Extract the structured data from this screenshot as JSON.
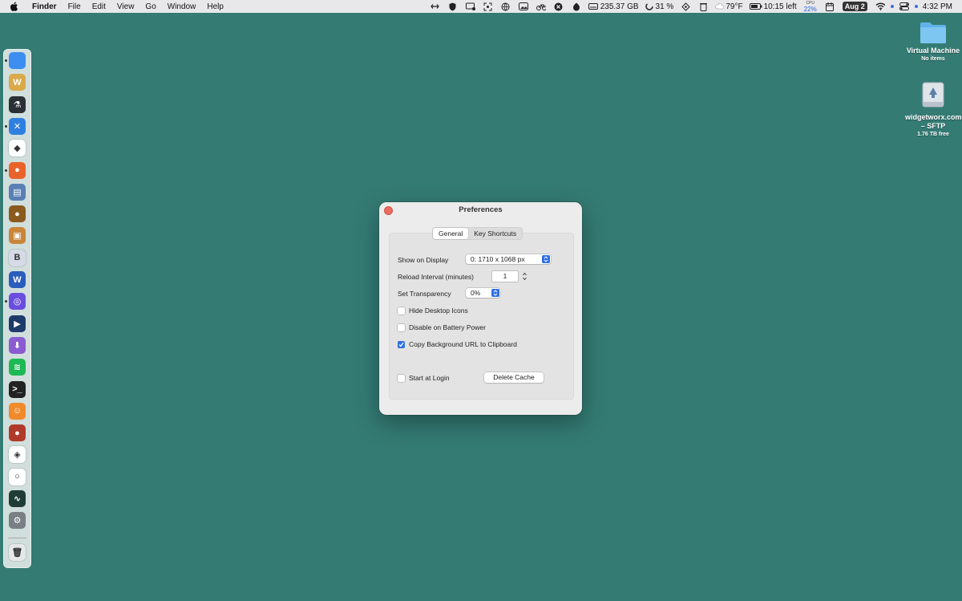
{
  "menubar": {
    "app_name": "Finder",
    "menus": [
      "File",
      "Edit",
      "View",
      "Go",
      "Window",
      "Help"
    ],
    "status": {
      "disk": "235.37 GB",
      "progress": "31 %",
      "weather": "79°F",
      "battery": "10:15 left",
      "cpu_label": "CPU",
      "cpu_value": "22%",
      "date": "Aug 2",
      "time": "4:32 PM"
    }
  },
  "desktop": {
    "items": [
      {
        "name": "Virtual Machine",
        "sub": "No items"
      },
      {
        "name": "widgetworx.com – SFTP",
        "sub": "1.76 TB free"
      }
    ]
  },
  "dock": {
    "apps": [
      {
        "name": "finder-icon",
        "color": "#3d8ef0",
        "glyph": ""
      },
      {
        "name": "word-legacy-icon",
        "color": "#d9a94a",
        "glyph": "W"
      },
      {
        "name": "flask-app-icon",
        "color": "#2b2f36",
        "glyph": "⚗"
      },
      {
        "name": "xcode-tools-icon",
        "color": "#2f7fe0",
        "glyph": "✕"
      },
      {
        "name": "brave-browser-icon",
        "color": "#ffffff",
        "glyph": "◆"
      },
      {
        "name": "firefox-icon",
        "color": "#e8632b",
        "glyph": "●"
      },
      {
        "name": "utility-app-icon",
        "color": "#5a7fb5",
        "glyph": "▤"
      },
      {
        "name": "acorn-app-icon",
        "color": "#8a5a1e",
        "glyph": "●"
      },
      {
        "name": "preview-app-icon",
        "color": "#c9863a",
        "glyph": "▣"
      },
      {
        "name": "bbedit-icon",
        "color": "#d6d9e6",
        "glyph": "B"
      },
      {
        "name": "word-icon",
        "color": "#2a5dbb",
        "glyph": "W"
      },
      {
        "name": "arc-browser-icon",
        "color": "#6a4ee0",
        "glyph": "◎"
      },
      {
        "name": "media-player-icon",
        "color": "#1d3a6b",
        "glyph": "▶"
      },
      {
        "name": "downloader-icon",
        "color": "#8a5bd1",
        "glyph": "⬇"
      },
      {
        "name": "spotify-icon",
        "color": "#1db954",
        "glyph": "≋"
      },
      {
        "name": "terminal-icon",
        "color": "#222222",
        "glyph": ">_"
      },
      {
        "name": "beta-app-icon",
        "color": "#f08a2a",
        "glyph": "☺"
      },
      {
        "name": "boxing-gloves-icon",
        "color": "#b03a2a",
        "glyph": "●"
      },
      {
        "name": "layers-app-icon",
        "color": "#ffffff",
        "glyph": "◈"
      },
      {
        "name": "circle-app-icon",
        "color": "#ffffff",
        "glyph": "○"
      },
      {
        "name": "activity-monitor-icon",
        "color": "#1f3d36",
        "glyph": "∿"
      },
      {
        "name": "system-settings-icon",
        "color": "#7a7f85",
        "glyph": "⚙"
      },
      {
        "name": "trash-icon",
        "color": "#e5e7e8",
        "glyph": "🗑"
      }
    ],
    "running_indices": [
      0,
      3,
      5,
      11
    ]
  },
  "preferences": {
    "title": "Preferences",
    "tabs": [
      {
        "label": "General",
        "active": true
      },
      {
        "label": "Key Shortcuts",
        "active": false
      }
    ],
    "show_on_display": {
      "label": "Show on Display",
      "value": "0: 1710 x 1068 px"
    },
    "reload_interval": {
      "label": "Reload Interval (minutes)",
      "value": "1"
    },
    "transparency": {
      "label": "Set Transparency",
      "value": "0%"
    },
    "hide_desktop_icons": {
      "label": "Hide Desktop Icons",
      "checked": false
    },
    "disable_on_battery": {
      "label": "Disable on Battery Power",
      "checked": false
    },
    "copy_background_url": {
      "label": "Copy Background URL to Clipboard",
      "checked": true
    },
    "start_at_login": {
      "label": "Start at Login",
      "checked": false
    },
    "delete_cache_label": "Delete Cache"
  },
  "colors": {
    "desktop": "#347b74",
    "accent": "#2f6fe3",
    "close": "#ed6a5e"
  }
}
